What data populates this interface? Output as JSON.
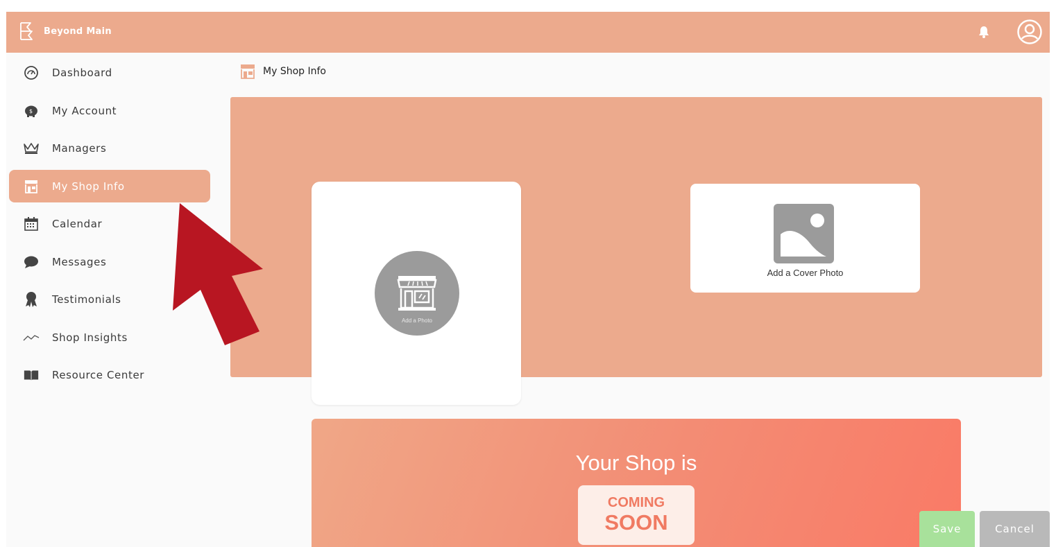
{
  "app": {
    "brand_name": "Beyond Main",
    "accent_color": "#ecaa8d"
  },
  "header": {
    "notification_icon": "bell-icon",
    "profile_icon": "user-circle-icon"
  },
  "sidebar": {
    "items": [
      {
        "label": "Dashboard",
        "icon": "speedometer-icon",
        "active": false
      },
      {
        "label": "My Account",
        "icon": "piggy-bank-icon",
        "active": false
      },
      {
        "label": "Managers",
        "icon": "crown-icon",
        "active": false
      },
      {
        "label": "My Shop Info",
        "icon": "storefront-icon",
        "active": true
      },
      {
        "label": "Calendar",
        "icon": "calendar-icon",
        "active": false
      },
      {
        "label": "Messages",
        "icon": "chat-bubble-icon",
        "active": false
      },
      {
        "label": "Testimonials",
        "icon": "award-icon",
        "active": false
      },
      {
        "label": "Shop Insights",
        "icon": "trend-line-icon",
        "active": false
      },
      {
        "label": "Resource Center",
        "icon": "book-icon",
        "active": false
      }
    ]
  },
  "main": {
    "page_title": "My Shop Info",
    "shop_photo": {
      "label": "Add a Photo"
    },
    "cover_photo": {
      "label": "Add a Cover Photo"
    },
    "coming_soon": {
      "title": "Your Shop is",
      "badge_line1": "COMING",
      "badge_line2": "SOON"
    }
  },
  "actions": {
    "save_label": "Save",
    "cancel_label": "Cancel"
  },
  "annotation": {
    "arrow_color": "#b81622"
  }
}
